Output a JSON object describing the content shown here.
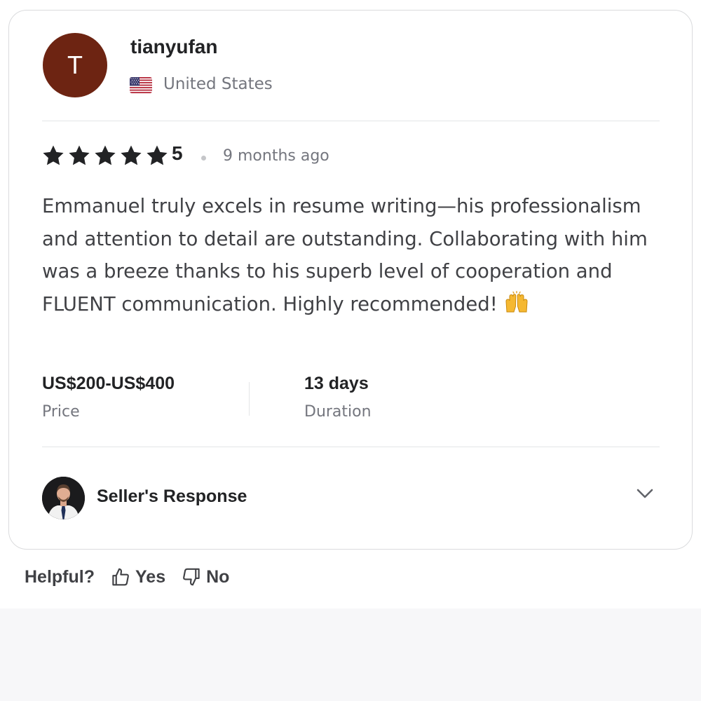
{
  "reviewer": {
    "avatar_initial": "T",
    "username": "tianyufan",
    "country": "United States",
    "flag_icon": "us-flag-icon"
  },
  "review": {
    "rating": "5",
    "star_count": 5,
    "time_ago": "9 months ago",
    "text": "Emmanuel truly excels in resume writing—his professionalism and attention to detail are outstanding. Collaborating with him was a breeze thanks to his superb level of cooperation and FLUENT communication. Highly recommended!",
    "emoji": "raising-hands-emoji"
  },
  "details": {
    "price_value": "US$200-US$400",
    "price_label": "Price",
    "duration_value": "13 days",
    "duration_label": "Duration"
  },
  "seller_response": {
    "title": "Seller's Response",
    "expanded": false
  },
  "helpful": {
    "label": "Helpful?",
    "yes": "Yes",
    "no": "No"
  },
  "colors": {
    "avatar_bg": "#6d2412",
    "text_primary": "#222325",
    "text_secondary": "#74767e",
    "star": "#222325"
  }
}
